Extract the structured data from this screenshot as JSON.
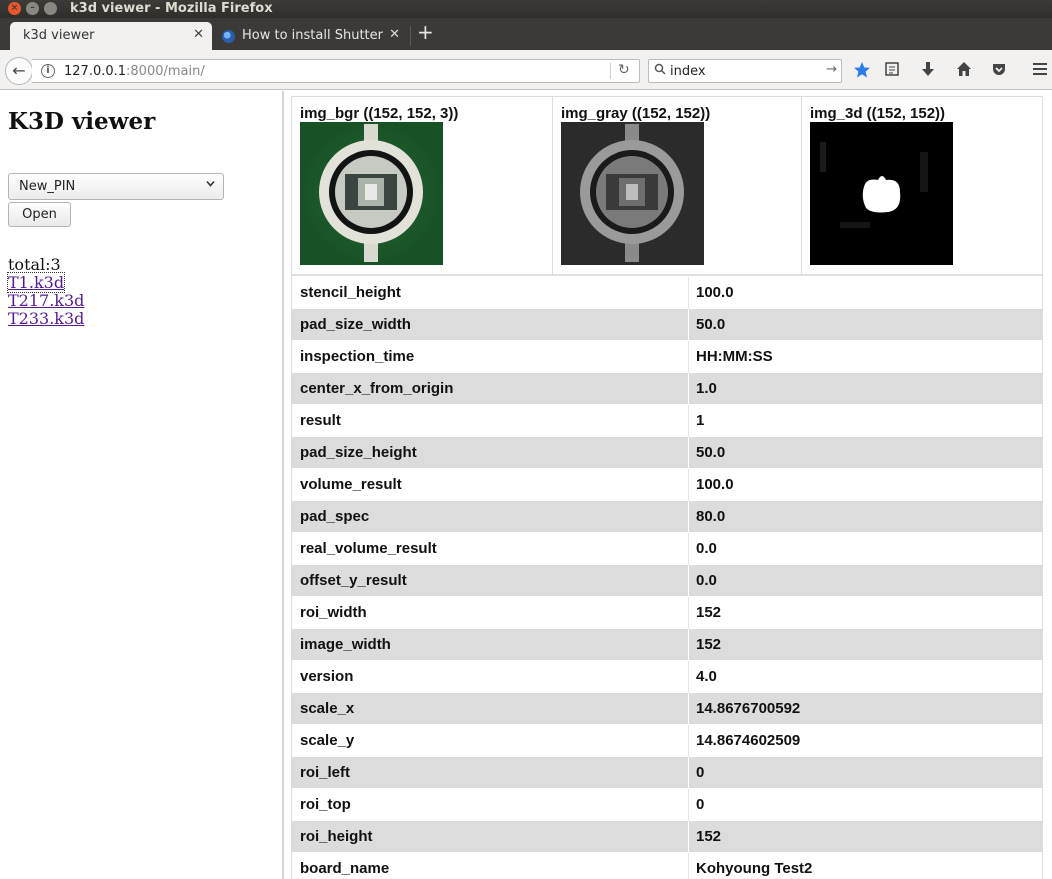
{
  "window": {
    "title": "k3d viewer - Mozilla Firefox"
  },
  "tabs": [
    {
      "label": "k3d viewer",
      "active": true
    },
    {
      "label": "How to install Shutter",
      "active": false
    }
  ],
  "navbar": {
    "url_host": "127.0.0.1",
    "url_rest": ":8000/main/",
    "search_value": "index",
    "icons": [
      "back-arrow-icon",
      "info-icon",
      "reload-icon",
      "search-icon",
      "bookmark-star-icon",
      "reading-list-icon",
      "download-icon",
      "home-icon",
      "pocket-icon",
      "menu-icon"
    ]
  },
  "sidebar": {
    "title": "K3D viewer",
    "select_value": "New_PIN",
    "open_label": "Open",
    "total": "total:3",
    "files": [
      "T1.k3d",
      "T217.k3d",
      "T233.k3d"
    ]
  },
  "images": [
    {
      "label": "img_bgr ((152, 152, 3))"
    },
    {
      "label": "img_gray ((152, 152))"
    },
    {
      "label": "img_3d ((152, 152))"
    }
  ],
  "rows": [
    {
      "key": "stencil_height",
      "value": "100.0"
    },
    {
      "key": "pad_size_width",
      "value": "50.0"
    },
    {
      "key": "inspection_time",
      "value": "HH:MM:SS"
    },
    {
      "key": "center_x_from_origin",
      "value": "1.0"
    },
    {
      "key": "result",
      "value": "1"
    },
    {
      "key": "pad_size_height",
      "value": "50.0"
    },
    {
      "key": "volume_result",
      "value": "100.0"
    },
    {
      "key": "pad_spec",
      "value": "80.0"
    },
    {
      "key": "real_volume_result",
      "value": "0.0"
    },
    {
      "key": "offset_y_result",
      "value": "0.0"
    },
    {
      "key": "roi_width",
      "value": "152"
    },
    {
      "key": "image_width",
      "value": "152"
    },
    {
      "key": "version",
      "value": "4.0"
    },
    {
      "key": "scale_x",
      "value": "14.8676700592"
    },
    {
      "key": "scale_y",
      "value": "14.8674602509"
    },
    {
      "key": "roi_left",
      "value": "0"
    },
    {
      "key": "roi_top",
      "value": "0"
    },
    {
      "key": "roi_height",
      "value": "152"
    },
    {
      "key": "board_name",
      "value": "Kohyoung Test2"
    }
  ],
  "colors": {
    "row_alt": "#dcdcdc",
    "link": "#551a8b",
    "bookmark_star": "#2b7de9"
  }
}
